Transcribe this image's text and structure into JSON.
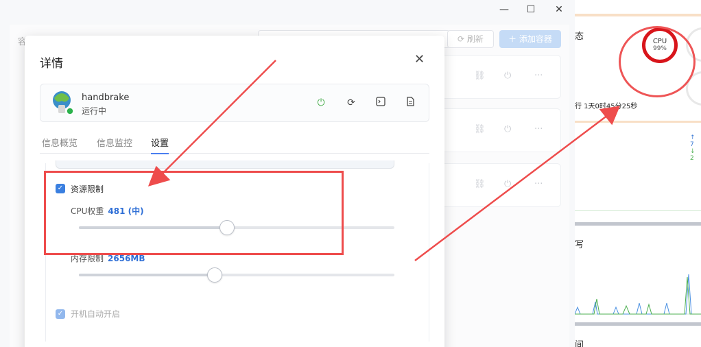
{
  "window": {
    "minimize_icon": "minimize-icon",
    "maximize_icon": "maximize-icon",
    "close_icon": "close-icon"
  },
  "container_panel": {
    "title": "容器",
    "refresh_label": "刷新",
    "add_label": "添加容器"
  },
  "right_panel": {
    "status_title": "态",
    "cpu_label": "CPU",
    "cpu_value": "99%",
    "cpu_percent": 99,
    "uptime": "行 1天0时45分25秒",
    "net_up": "7",
    "net_down": "2",
    "disk_title": "写",
    "time_title": "间"
  },
  "modal": {
    "title": "详情",
    "app": {
      "name": "handbrake",
      "status": "运行中"
    },
    "tabs": [
      {
        "label": "信息概览"
      },
      {
        "label": "信息监控"
      },
      {
        "label": "设置"
      }
    ],
    "active_tab": "设置",
    "settings": {
      "resource_limit_label": "资源限制",
      "resource_limit_checked": true,
      "cpu_weight_label": "CPU权重",
      "cpu_weight_value": "481 (中)",
      "cpu_weight_fraction": 0.47,
      "memory_limit_label": "内存限制",
      "memory_limit_value": "2656MB",
      "memory_limit_fraction": 0.43,
      "autostart_label": "开机自动开启",
      "autostart_checked": true
    }
  },
  "colors": {
    "accent": "#3a7fe0",
    "annotation": "#ee4c4c",
    "cpu_ring": "#d8151b",
    "running": "#2bb24c"
  }
}
